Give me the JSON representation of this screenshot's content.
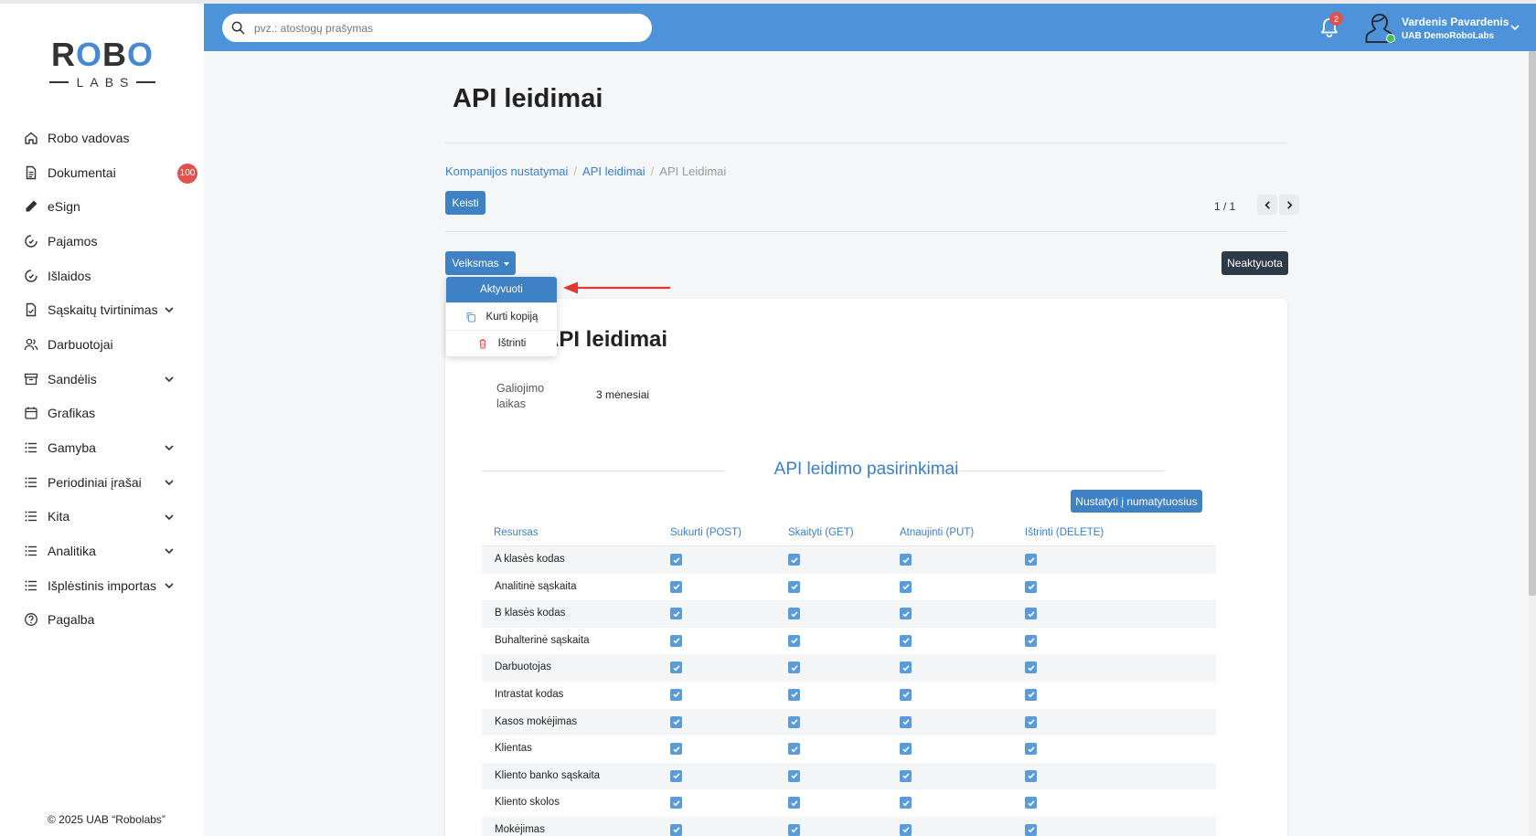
{
  "sidebar": {
    "logo": {
      "top": "ROBO",
      "bottom": "LABS"
    },
    "items": [
      {
        "label": "Robo vadovas",
        "icon": "home-icon",
        "has_chevron": false
      },
      {
        "label": "Dokumentai",
        "icon": "document-icon",
        "has_chevron": false,
        "badge": "100"
      },
      {
        "label": "eSign",
        "icon": "pen-icon",
        "has_chevron": false
      },
      {
        "label": "Pajamos",
        "icon": "income-icon",
        "has_chevron": false
      },
      {
        "label": "Išlaidos",
        "icon": "expense-icon",
        "has_chevron": false
      },
      {
        "label": "Sąskaitų tvirtinimas",
        "icon": "file-check-icon",
        "has_chevron": true
      },
      {
        "label": "Darbuotojai",
        "icon": "users-icon",
        "has_chevron": false
      },
      {
        "label": "Sandėlis",
        "icon": "archive-icon",
        "has_chevron": true
      },
      {
        "label": "Grafikas",
        "icon": "calendar-icon",
        "has_chevron": false
      },
      {
        "label": "Gamyba",
        "icon": "list-icon",
        "has_chevron": true
      },
      {
        "label": "Periodiniai įrašai",
        "icon": "list-icon",
        "has_chevron": true
      },
      {
        "label": "Kita",
        "icon": "list-icon",
        "has_chevron": true
      },
      {
        "label": "Analitika",
        "icon": "list-icon",
        "has_chevron": true
      },
      {
        "label": "Išplėstinis importas",
        "icon": "list-icon",
        "has_chevron": true
      },
      {
        "label": "Pagalba",
        "icon": "help-icon",
        "has_chevron": false
      }
    ],
    "copyright": "© 2025 UAB “Robolabs”"
  },
  "header": {
    "search_placeholder": "pvz.: atostogų prašymas",
    "notifications_count": "2",
    "user_name": "Vardenis Pavardenis",
    "user_company": "UAB DemoRoboLabs"
  },
  "page": {
    "title": "API leidimai",
    "breadcrumb": [
      "Kompanijos nustatymai",
      "API leidimai",
      "API Leidimai"
    ],
    "edit_button": "Keisti",
    "pager": "1 / 1",
    "action_button": "Veiksmas",
    "status_badge": "Neaktyuota"
  },
  "dropdown": {
    "items": [
      {
        "label": "Aktyvuoti",
        "icon": "",
        "active": true
      },
      {
        "label": "Kurti kopiją",
        "icon": "copy-icon",
        "active": false
      },
      {
        "label": "Ištrinti",
        "icon": "trash-icon",
        "active": false
      }
    ]
  },
  "card": {
    "title": "API leidimai",
    "field_label": "Galiojimo laikas",
    "field_value": "3 mėnesiai",
    "section_title": "API leidimo pasirinkimai",
    "defaults_button": "Nustatyti į numatytuosius"
  },
  "permissions": {
    "columns": [
      "Resursas",
      "Sukurti (POST)",
      "Skaityti (GET)",
      "Atnaujinti (PUT)",
      "Ištrinti (DELETE)"
    ],
    "rows": [
      {
        "name": "A klasės kodas",
        "checks": [
          true,
          true,
          true,
          true
        ]
      },
      {
        "name": "Analitinė sąskaita",
        "checks": [
          true,
          true,
          true,
          true
        ]
      },
      {
        "name": "B klasės kodas",
        "checks": [
          true,
          true,
          true,
          true
        ]
      },
      {
        "name": "Buhalterinė sąskaita",
        "checks": [
          true,
          true,
          true,
          true
        ]
      },
      {
        "name": "Darbuotojas",
        "checks": [
          true,
          true,
          true,
          true
        ]
      },
      {
        "name": "Intrastat kodas",
        "checks": [
          true,
          true,
          true,
          true
        ]
      },
      {
        "name": "Kasos mokėjimas",
        "checks": [
          true,
          true,
          true,
          true
        ]
      },
      {
        "name": "Klientas",
        "checks": [
          true,
          true,
          true,
          true
        ]
      },
      {
        "name": "Kliento banko sąskaita",
        "checks": [
          true,
          true,
          true,
          true
        ]
      },
      {
        "name": "Kliento skolos",
        "checks": [
          true,
          true,
          true,
          true
        ]
      },
      {
        "name": "Mokėjimas",
        "checks": [
          true,
          true,
          true,
          true
        ]
      }
    ]
  },
  "colors": {
    "header_bg": "#4d93d9",
    "primary": "#3f81c5",
    "link": "#3b7ec6",
    "badge_red": "#e0524d",
    "annotation_arrow": "#e2362f"
  }
}
